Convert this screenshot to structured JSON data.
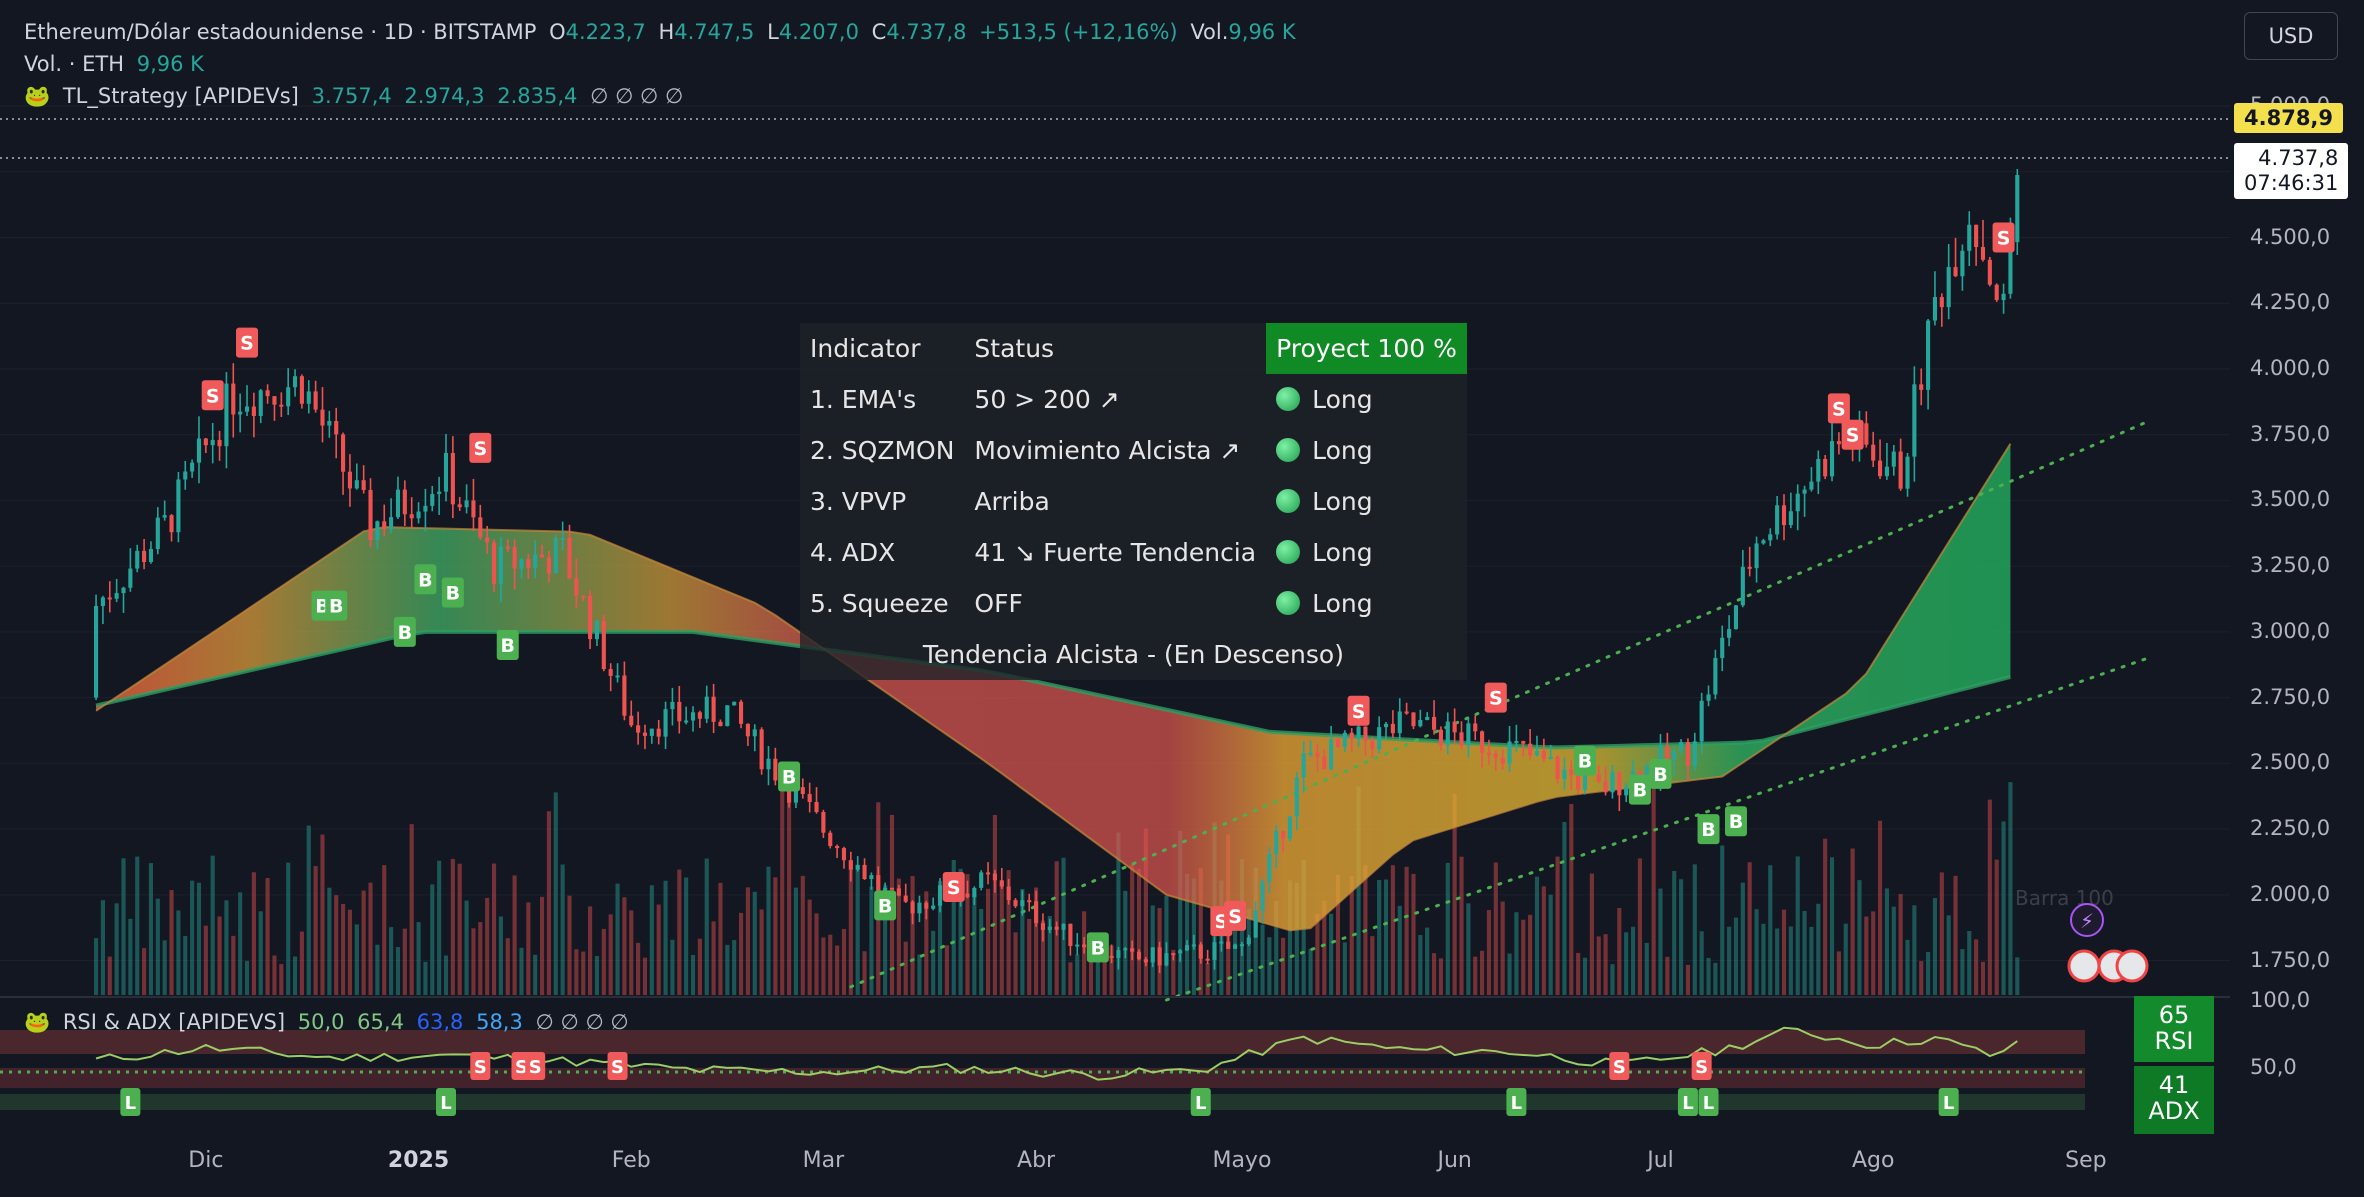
{
  "header": {
    "symbol": "Ethereum/Dólar estadounidense · 1D · BITSTAMP",
    "o_label": "O",
    "o_value": "4.223,7",
    "h_label": "H",
    "h_value": "4.747,5",
    "l_label": "L",
    "l_value": "4.207,0",
    "c_label": "C",
    "c_value": "4.737,8",
    "change": "+513,5 (+12,16%)",
    "vol_label": "Vol.",
    "vol_value": "9,96 K"
  },
  "volume_legend": {
    "label": "Vol. · ETH",
    "value": "9,96 K"
  },
  "strategy_legend": {
    "name": "TL_Strategy [APIDEVs]",
    "values": [
      "3.757,4",
      "2.974,3",
      "2.835,4"
    ],
    "nulls": "∅ ∅ ∅ ∅"
  },
  "currency": "USD",
  "price_axis": {
    "labels": [
      "5.000,0",
      "4.750,0",
      "4.500,0",
      "4.250,0",
      "4.000,0",
      "3.750,0",
      "3.500,0",
      "3.250,0",
      "3.000,0",
      "2.750,0",
      "2.500,0",
      "2.250,0",
      "2.000,0",
      "1.750,0"
    ],
    "tag_target": "4.878,9",
    "tag_last": "4.737,8",
    "tag_countdown": "07:46:31"
  },
  "status_table": {
    "headers": [
      "Indicator",
      "Status",
      "Proyect 100 %"
    ],
    "rows": [
      {
        "indicator": "1. EMA's",
        "status": "50 > 200 ↗",
        "signal": "Long"
      },
      {
        "indicator": "2. SQZMON",
        "status": "Movimiento Alcista ↗",
        "signal": "Long"
      },
      {
        "indicator": "3. VPVP",
        "status": "Arriba",
        "signal": "Long"
      },
      {
        "indicator": "4. ADX",
        "status": "41 ↘ Fuerte Tendencia",
        "signal": "Long"
      },
      {
        "indicator": "5. Squeeze",
        "status": "OFF",
        "signal": "Long"
      }
    ],
    "trend": "Tendencia Alcista - (En Descenso)"
  },
  "rsi_panel": {
    "name": "RSI & ADX [APIDEVS]",
    "values": [
      "50,0",
      "65,4",
      "63,8",
      "58,3"
    ],
    "nulls": "∅ ∅ ∅ ∅",
    "axis_labels": [
      "100,0",
      "50,0"
    ],
    "rsi_value": "65",
    "rsi_label": "RSI",
    "adx_value": "41",
    "adx_label": "ADX"
  },
  "watermark": "Barra 100",
  "x_labels": [
    "Dic",
    "2025",
    "Feb",
    "Mar",
    "Abr",
    "Mayo",
    "Jun",
    "Jul",
    "Ago",
    "Sep"
  ],
  "colors": {
    "up": "#26a69a",
    "down": "#ef5350",
    "background": "#131722",
    "target_tag": "#f4e04d"
  },
  "chart_data": {
    "type": "candlestick",
    "title": "Ethereum/Dólar estadounidense · 1D · BITSTAMP",
    "ylim": [
      1600,
      5080
    ],
    "y_scale": "linear",
    "x_range": [
      "2024-11-15",
      "2025-09-10"
    ],
    "ohlc": [
      [
        "2024-11-15",
        2750,
        3200,
        2600,
        3100
      ],
      [
        "2024-11-25",
        3100,
        3550,
        3000,
        3400
      ],
      [
        "2024-12-05",
        3400,
        4100,
        3350,
        3900
      ],
      [
        "2024-12-15",
        3900,
        4050,
        3650,
        3950
      ],
      [
        "2024-12-25",
        3950,
        3980,
        3350,
        3400
      ],
      [
        "2025-01-05",
        3400,
        3700,
        3250,
        3600
      ],
      [
        "2025-01-12",
        3600,
        3600,
        3150,
        3250
      ],
      [
        "2025-01-22",
        3250,
        3450,
        3150,
        3300
      ],
      [
        "2025-02-01",
        3300,
        3350,
        2350,
        2650
      ],
      [
        "2025-02-15",
        2650,
        2850,
        2550,
        2700
      ],
      [
        "2025-03-01",
        2700,
        2750,
        2050,
        2250
      ],
      [
        "2025-03-12",
        2250,
        2300,
        1850,
        1950
      ],
      [
        "2025-03-25",
        1950,
        2100,
        1800,
        2050
      ],
      [
        "2025-04-05",
        2050,
        2050,
        1750,
        1850
      ],
      [
        "2025-04-15",
        1850,
        1900,
        1600,
        1750
      ],
      [
        "2025-05-01",
        1750,
        1850,
        1700,
        1800
      ],
      [
        "2025-05-10",
        1800,
        2550,
        1780,
        2500
      ],
      [
        "2025-05-25",
        2500,
        2750,
        2450,
        2650
      ],
      [
        "2025-06-10",
        2650,
        2850,
        2500,
        2550
      ],
      [
        "2025-06-22",
        2550,
        2600,
        2150,
        2400
      ],
      [
        "2025-07-05",
        2400,
        2600,
        2350,
        2550
      ],
      [
        "2025-07-15",
        2550,
        3450,
        2500,
        3350
      ],
      [
        "2025-07-28",
        3350,
        3900,
        3350,
        3750
      ],
      [
        "2025-08-05",
        3750,
        3800,
        3400,
        3600
      ],
      [
        "2025-08-10",
        3600,
        4300,
        3550,
        4250
      ],
      [
        "2025-08-15",
        4250,
        4750,
        4200,
        4600
      ],
      [
        "2025-08-20",
        4600,
        4650,
        4050,
        4223.7
      ],
      [
        "2025-08-22",
        4223.7,
        4747.5,
        4207.0,
        4737.8
      ]
    ],
    "ema50": [
      [
        "2024-11-15",
        2700
      ],
      [
        "2024-12-25",
        3400
      ],
      [
        "2025-01-25",
        3380
      ],
      [
        "2025-02-20",
        3100
      ],
      [
        "2025-03-25",
        2500
      ],
      [
        "2025-04-20",
        2000
      ],
      [
        "2025-05-10",
        1850
      ],
      [
        "2025-05-25",
        2200
      ],
      [
        "2025-06-15",
        2370
      ],
      [
        "2025-07-10",
        2450
      ],
      [
        "2025-07-30",
        2800
      ],
      [
        "2025-08-22",
        3757.4
      ]
    ],
    "ema200": [
      [
        "2024-11-15",
        2720
      ],
      [
        "2025-01-01",
        3000
      ],
      [
        "2025-02-10",
        3000
      ],
      [
        "2025-03-25",
        2850
      ],
      [
        "2025-05-05",
        2620
      ],
      [
        "2025-06-15",
        2560
      ],
      [
        "2025-07-15",
        2580
      ],
      [
        "2025-08-22",
        2835.4
      ]
    ],
    "ema_mid_end": 2974.3,
    "channel_upper": [
      [
        "2025-03-05",
        1650
      ],
      [
        "2025-09-10",
        3800
      ]
    ],
    "channel_lower": [
      [
        "2025-04-20",
        1600
      ],
      [
        "2025-09-10",
        2900
      ]
    ],
    "signals": [
      {
        "date": "2024-12-07",
        "type": "S",
        "price": 4100
      },
      {
        "date": "2024-12-02",
        "type": "S",
        "price": 3900
      },
      {
        "date": "2025-01-10",
        "type": "S",
        "price": 3700
      },
      {
        "date": "2025-03-20",
        "type": "S",
        "price": 2030
      },
      {
        "date": "2025-04-28",
        "type": "S",
        "price": 1900
      },
      {
        "date": "2025-04-30",
        "type": "S",
        "price": 1920
      },
      {
        "date": "2025-05-18",
        "type": "S",
        "price": 2700
      },
      {
        "date": "2025-06-07",
        "type": "S",
        "price": 2750
      },
      {
        "date": "2025-07-27",
        "type": "S",
        "price": 3850
      },
      {
        "date": "2025-07-29",
        "type": "S",
        "price": 3750
      },
      {
        "date": "2025-08-20",
        "type": "S",
        "price": 4500
      },
      {
        "date": "2024-12-18",
        "type": "B",
        "price": 3100
      },
      {
        "date": "2024-12-20",
        "type": "B",
        "price": 3100
      },
      {
        "date": "2024-12-30",
        "type": "B",
        "price": 3000
      },
      {
        "date": "2025-01-02",
        "type": "B",
        "price": 3200
      },
      {
        "date": "2025-01-06",
        "type": "B",
        "price": 3150
      },
      {
        "date": "2025-01-14",
        "type": "B",
        "price": 2950
      },
      {
        "date": "2025-02-24",
        "type": "B",
        "price": 2450
      },
      {
        "date": "2025-03-10",
        "type": "B",
        "price": 1960
      },
      {
        "date": "2025-04-10",
        "type": "B",
        "price": 1800
      },
      {
        "date": "2025-06-20",
        "type": "B",
        "price": 2510
      },
      {
        "date": "2025-06-28",
        "type": "B",
        "price": 2400
      },
      {
        "date": "2025-07-01",
        "type": "B",
        "price": 2460
      },
      {
        "date": "2025-07-08",
        "type": "B",
        "price": 2250
      },
      {
        "date": "2025-07-12",
        "type": "B",
        "price": 2280
      }
    ],
    "rsi_ylim": [
      0,
      110
    ],
    "rsi": [
      [
        "2024-11-15",
        50
      ],
      [
        "2024-12-01",
        62
      ],
      [
        "2024-12-20",
        52
      ],
      [
        "2025-01-05",
        55
      ],
      [
        "2025-01-25",
        48
      ],
      [
        "2025-02-10",
        40
      ],
      [
        "2025-03-01",
        38
      ],
      [
        "2025-03-20",
        42
      ],
      [
        "2025-04-10",
        35
      ],
      [
        "2025-04-25",
        40
      ],
      [
        "2025-05-10",
        72
      ],
      [
        "2025-05-25",
        60
      ],
      [
        "2025-06-10",
        58
      ],
      [
        "2025-06-25",
        45
      ],
      [
        "2025-07-10",
        60
      ],
      [
        "2025-07-20",
        80
      ],
      [
        "2025-08-01",
        65
      ],
      [
        "2025-08-10",
        72
      ],
      [
        "2025-08-18",
        55
      ],
      [
        "2025-08-22",
        65
      ]
    ],
    "rsi_signals": [
      {
        "date": "2024-11-20",
        "type": "L"
      },
      {
        "date": "2025-01-05",
        "type": "L"
      },
      {
        "date": "2025-01-10",
        "type": "S"
      },
      {
        "date": "2025-01-16",
        "type": "S"
      },
      {
        "date": "2025-01-18",
        "type": "S"
      },
      {
        "date": "2025-01-30",
        "type": "S"
      },
      {
        "date": "2025-04-25",
        "type": "L"
      },
      {
        "date": "2025-06-10",
        "type": "L"
      },
      {
        "date": "2025-06-25",
        "type": "S"
      },
      {
        "date": "2025-07-05",
        "type": "L"
      },
      {
        "date": "2025-07-08",
        "type": "L"
      },
      {
        "date": "2025-07-07",
        "type": "S"
      },
      {
        "date": "2025-08-12",
        "type": "L"
      }
    ]
  }
}
